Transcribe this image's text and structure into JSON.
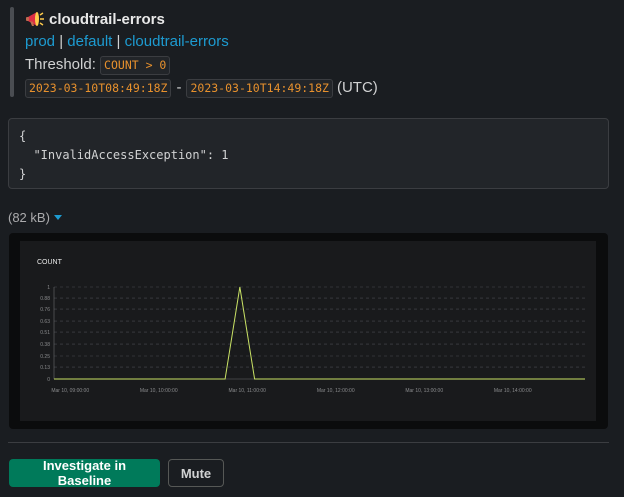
{
  "message": {
    "icon": "megaphone-icon",
    "title": "cloudtrail-errors",
    "links": [
      "prod",
      "default",
      "cloudtrail-errors"
    ],
    "link_separator": "|",
    "threshold_label": "Threshold:",
    "threshold_value": "COUNT > 0",
    "time_start": "2023-03-10T08:49:18Z",
    "time_sep": "-",
    "time_end": "2023-03-10T14:49:18Z",
    "timezone": "(UTC)"
  },
  "json_output": "{\n  \"InvalidAccessException\": 1\n}",
  "attachment": {
    "size": "(82 kB)"
  },
  "colors": {
    "link": "#1d9bd1",
    "code": "#e8912d",
    "primary_button": "#007a5a",
    "line": "#c9e265"
  },
  "chart_data": {
    "type": "line",
    "title": "COUNT",
    "xlabel": "",
    "ylabel": "",
    "ylim": [
      0,
      1
    ],
    "y_ticks": [
      "0",
      "0.13",
      "0.25",
      "0.38",
      "0.51",
      "0.63",
      "0.76",
      "0.88",
      "1"
    ],
    "x_ticks": [
      "Mar 10, 09:00:00",
      "Mar 10, 10:00:00",
      "Mar 10, 11:00:00",
      "Mar 10, 12:00:00",
      "Mar 10, 13:00:00",
      "Mar 10, 14:00:00"
    ],
    "grid": true,
    "series": [
      {
        "x": [
          "2023-03-10T08:49",
          "2023-03-10T10:45",
          "2023-03-10T10:55",
          "2023-03-10T11:05",
          "2023-03-10T14:49"
        ],
        "values": [
          0,
          0,
          1,
          0,
          0
        ]
      }
    ]
  },
  "actions": {
    "investigate": "Investigate in Baseline",
    "mute": "Mute"
  }
}
